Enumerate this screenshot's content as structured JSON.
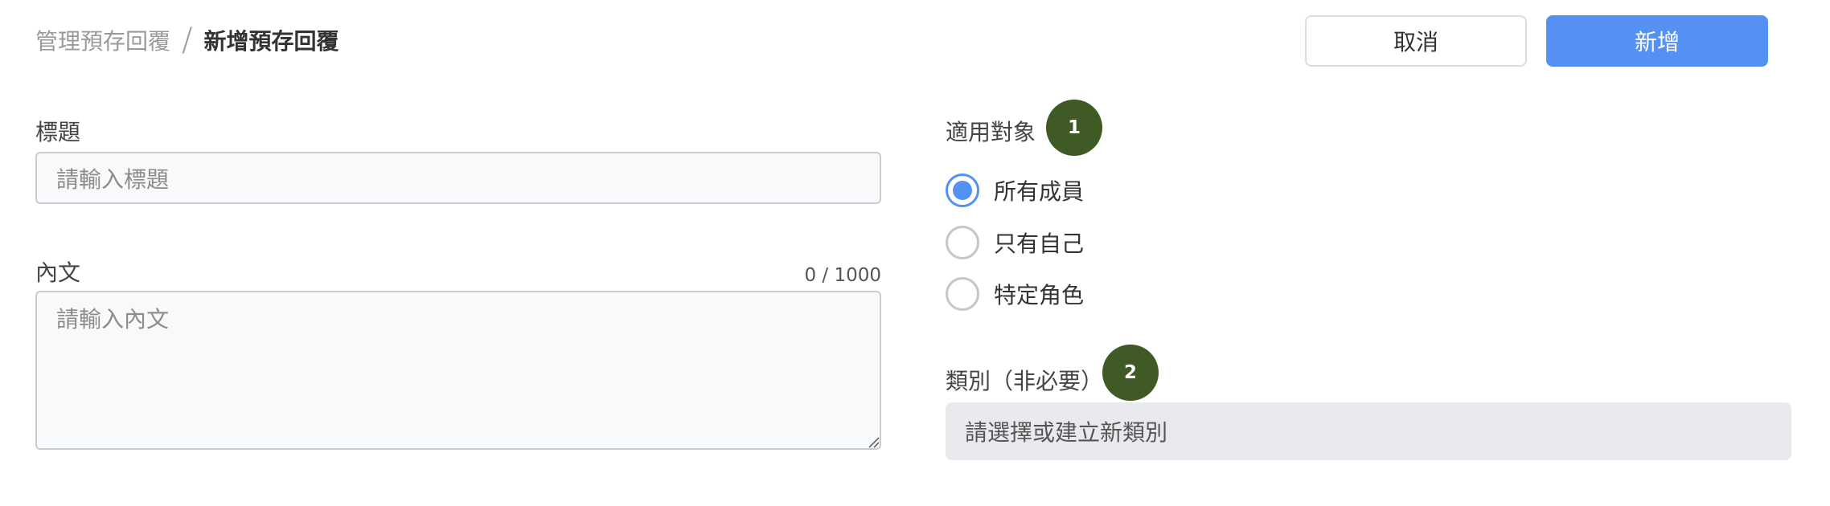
{
  "header": {
    "breadcrumb_parent": "管理預存回覆",
    "breadcrumb_separator": "/",
    "breadcrumb_current": "新增預存回覆",
    "cancel_label": "取消",
    "add_label": "新增"
  },
  "form": {
    "title_label": "標題",
    "title_placeholder": "請輸入標題",
    "body_label": "內文",
    "body_placeholder": "請輸入內文",
    "char_counter": "0 / 1000"
  },
  "audience": {
    "label": "適用對象",
    "marker": "1",
    "options": [
      {
        "label": "所有成員",
        "checked": true
      },
      {
        "label": "只有自己",
        "checked": false
      },
      {
        "label": "特定角色",
        "checked": false
      }
    ]
  },
  "category": {
    "label": "類別（非必要）",
    "marker": "2",
    "placeholder": "請選擇或建立新類別"
  },
  "colors": {
    "accent": "#5591f2",
    "marker": "#3f5a24"
  }
}
